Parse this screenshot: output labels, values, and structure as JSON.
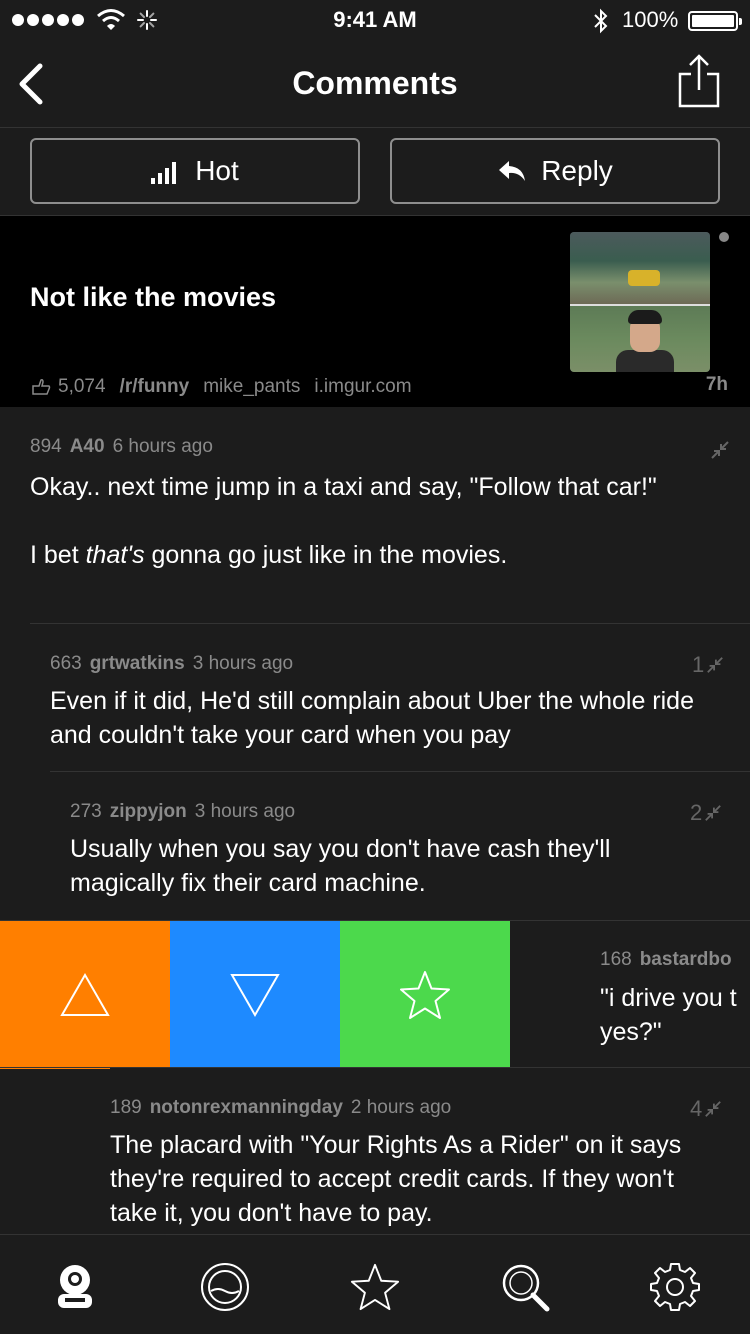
{
  "status_bar": {
    "time": "9:41 AM",
    "battery": "100%"
  },
  "nav": {
    "title": "Comments"
  },
  "segments": {
    "sort_label": "Hot",
    "reply_label": "Reply"
  },
  "post": {
    "title": "Not like the movies",
    "score": "5,074",
    "subreddit": "/r/funny",
    "author": "mike_pants",
    "domain": "i.imgur.com",
    "age": "7h"
  },
  "comments": [
    {
      "score": "894",
      "user": "A40",
      "time": "6 hours ago",
      "body_line1": "Okay.. next time jump in a taxi and say, \"Follow that car!\"",
      "body_prefix": "I bet ",
      "body_emph": "that's",
      "body_suffix": " gonna go just like in the movies.",
      "depth": ""
    },
    {
      "score": "663",
      "user": "grtwatkins",
      "time": "3 hours ago",
      "body": "Even if it did, He'd still complain about Uber the whole ride and couldn't take your card when you pay",
      "depth": "1"
    },
    {
      "score": "273",
      "user": "zippyjon",
      "time": "3 hours ago",
      "body": "Usually when you say you don't have cash they'll magically fix their card machine.",
      "depth": "2"
    },
    {
      "score": "168",
      "user": "bastardbo",
      "body": "\"i drive you t yes?\"",
      "depth": ""
    },
    {
      "score": "189",
      "user": "notonrexmanningday",
      "time": "2 hours ago",
      "body": "The placard with \"Your Rights As a Rider\" on it says they're required to accept credit cards. If they won't take it, you don't have to pay.",
      "depth": "4"
    }
  ],
  "swipe_actions": {
    "upvote_color": "#ff7f00",
    "downvote_color": "#1e8aff",
    "save_color": "#4cd94c"
  },
  "tab_bar": {
    "items": [
      "diver-icon",
      "porthole-icon",
      "star-icon",
      "search-icon",
      "gear-icon"
    ]
  }
}
